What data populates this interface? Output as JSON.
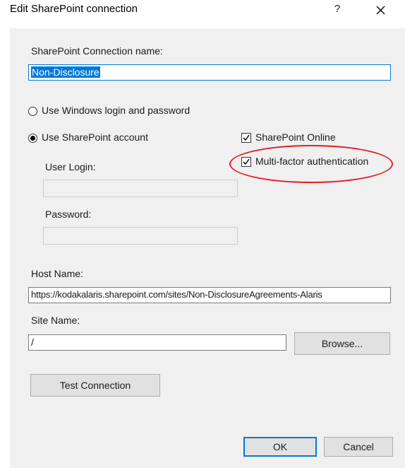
{
  "window": {
    "title": "Edit SharePoint connection",
    "help_label": "?",
    "close_icon": "close-icon"
  },
  "connection": {
    "name_label": "SharePoint Connection name:",
    "name_value": "Non-Disclosure"
  },
  "auth": {
    "windows_label": "Use Windows login and password",
    "windows_selected": false,
    "sharepoint_label": "Use SharePoint account",
    "sharepoint_selected": true,
    "sharepoint_online_label": "SharePoint Online",
    "sharepoint_online_checked": true,
    "mfa_label": "Multi-factor authentication",
    "mfa_checked": true
  },
  "credentials": {
    "user_login_label": "User Login:",
    "user_login_value": "",
    "password_label": "Password:",
    "password_value": ""
  },
  "host": {
    "label": "Host Name:",
    "value": "https://kodakalaris.sharepoint.com/sites/Non-DisclosureAgreements-Alaris"
  },
  "site": {
    "label": "Site Name:",
    "value": "/",
    "browse_label": "Browse..."
  },
  "actions": {
    "test_label": "Test Connection",
    "ok_label": "OK",
    "cancel_label": "Cancel"
  },
  "colors": {
    "accent": "#0078d7",
    "annotation": "#e0201e",
    "dialog_bg": "#f0f0f0"
  }
}
